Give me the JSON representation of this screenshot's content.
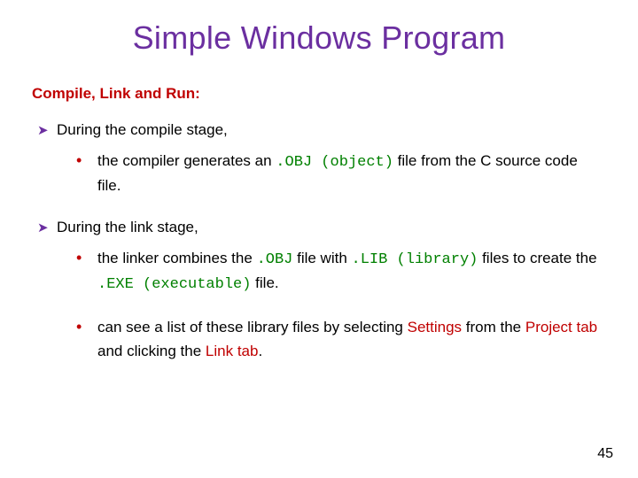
{
  "title": "Simple Windows Program",
  "subhead": "Compile, Link and Run:",
  "sections": [
    {
      "heading": "During the compile stage,",
      "bullets": [
        {
          "pre": "the compiler generates an",
          "code": ".OBJ (object)",
          "post": " file from the C source code file."
        }
      ]
    },
    {
      "heading": "During the link stage,",
      "bullets": [
        {
          "pre": "the linker combines the",
          "code": ".OBJ",
          "mid1": " file with",
          "code2": ".LIB (library)",
          "mid2": " files to create the",
          "code3": ".EXE (executable)",
          "post": " file."
        },
        {
          "pre": "can see a list of these library files by selecting ",
          "kw1": "Settings",
          "mid1": " from the ",
          "kw2": "Project tab",
          "mid2": " and clicking the ",
          "kw3": "Link tab",
          "post": "."
        }
      ]
    }
  ],
  "page": "45"
}
